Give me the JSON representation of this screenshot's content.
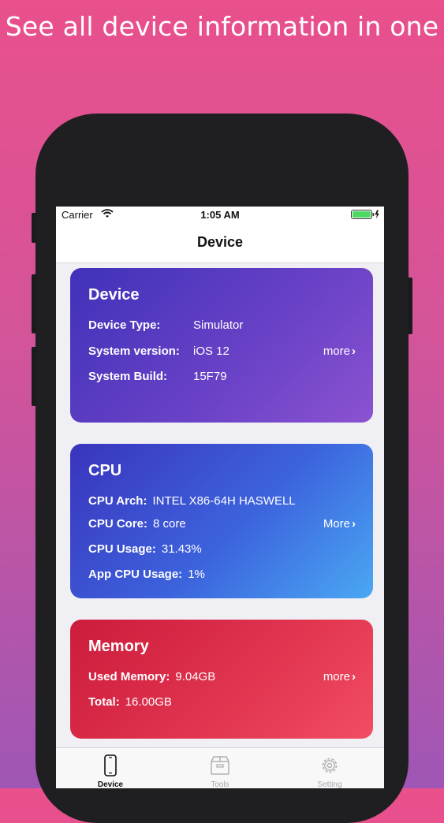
{
  "headline": "See all device information in one",
  "status_bar": {
    "carrier": "Carrier",
    "time": "1:05 AM"
  },
  "nav": {
    "title": "Device"
  },
  "device_card": {
    "title": "Device",
    "rows": [
      {
        "label": "Device Type:",
        "value": "Simulator"
      },
      {
        "label": "System version:",
        "value": "iOS 12"
      },
      {
        "label": "System Build:",
        "value": "15F79"
      }
    ],
    "more_label": "more"
  },
  "cpu_card": {
    "title": "CPU",
    "rows": [
      {
        "label": "CPU Arch:",
        "value": "INTEL X86-64H HASWELL"
      },
      {
        "label": "CPU Core:",
        "value": "8 core"
      },
      {
        "label": "CPU Usage:",
        "value": "31.43%"
      },
      {
        "label": "App CPU Usage:",
        "value": "1%"
      }
    ],
    "more_label": "More"
  },
  "memory_card": {
    "title": "Memory",
    "rows": [
      {
        "label": "Used Memory:",
        "value": "9.04GB"
      },
      {
        "label": "Total:",
        "value": "16.00GB"
      }
    ],
    "more_label": "more"
  },
  "tab_bar": {
    "tabs": [
      {
        "label": "Device",
        "icon": "phone-icon",
        "active": true
      },
      {
        "label": "Tools",
        "icon": "box-icon",
        "active": false
      },
      {
        "label": "Setting",
        "icon": "gear-icon",
        "active": false
      }
    ]
  },
  "colors": {
    "background_top": "#e9508c",
    "background_bottom": "#9f56b5",
    "device_card": "#5a3cc2",
    "cpu_card": "#3c63dd",
    "memory_card": "#e23651",
    "battery": "#4cd964"
  }
}
